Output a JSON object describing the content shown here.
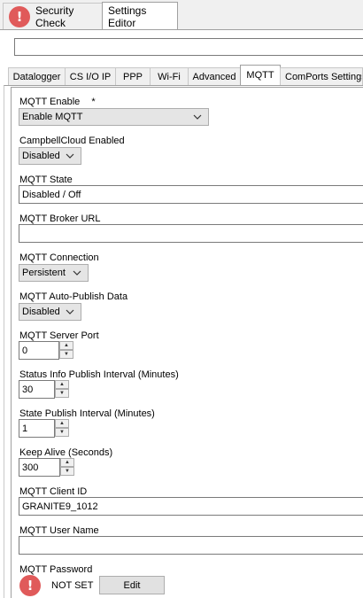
{
  "top_tabs": [
    {
      "label": "Security Check",
      "has_alert_icon": true,
      "active": false
    },
    {
      "label": "Settings Editor",
      "has_alert_icon": false,
      "active": true
    }
  ],
  "path_value": "",
  "sub_tabs": [
    {
      "label": "Datalogger",
      "active": false
    },
    {
      "label": "CS I/O IP",
      "active": false
    },
    {
      "label": "PPP",
      "active": false
    },
    {
      "label": "Wi-Fi",
      "active": false
    },
    {
      "label": "Advanced",
      "active": false
    },
    {
      "label": "MQTT",
      "active": true
    },
    {
      "label": "ComPorts Settings",
      "active": false
    }
  ],
  "fields": {
    "mqtt_enable": {
      "label": "MQTT Enable",
      "required_marker": "*",
      "value": "Enable MQTT"
    },
    "campbell_cloud": {
      "label": "CampbellCloud Enabled",
      "value": "Disabled"
    },
    "mqtt_state": {
      "label": "MQTT State",
      "value": "Disabled / Off"
    },
    "broker_url": {
      "label": "MQTT Broker URL",
      "value": ""
    },
    "connection": {
      "label": "MQTT Connection",
      "value": "Persistent"
    },
    "auto_publish": {
      "label": "MQTT Auto-Publish Data",
      "value": "Disabled"
    },
    "server_port": {
      "label": "MQTT Server Port",
      "value": "0"
    },
    "status_interval": {
      "label": "Status Info Publish Interval (Minutes)",
      "value": "30"
    },
    "state_interval": {
      "label": "State Publish Interval (Minutes)",
      "value": "1"
    },
    "keep_alive": {
      "label": "Keep Alive (Seconds)",
      "value": "300"
    },
    "client_id": {
      "label": "MQTT Client ID",
      "value": "GRANITE9_1012"
    },
    "user_name": {
      "label": "MQTT User Name",
      "value": ""
    },
    "password": {
      "label": "MQTT Password",
      "status": "NOT SET",
      "button": "Edit"
    }
  },
  "colors": {
    "alert": "#e05a5a",
    "background": "#f0f0f0",
    "content": "#ffffff"
  },
  "icons": {
    "alert": "exclamation-alert-icon",
    "dropdown": "chevron-down-icon",
    "spin_up": "spin-up-arrow-icon",
    "spin_down": "spin-down-arrow-icon"
  }
}
